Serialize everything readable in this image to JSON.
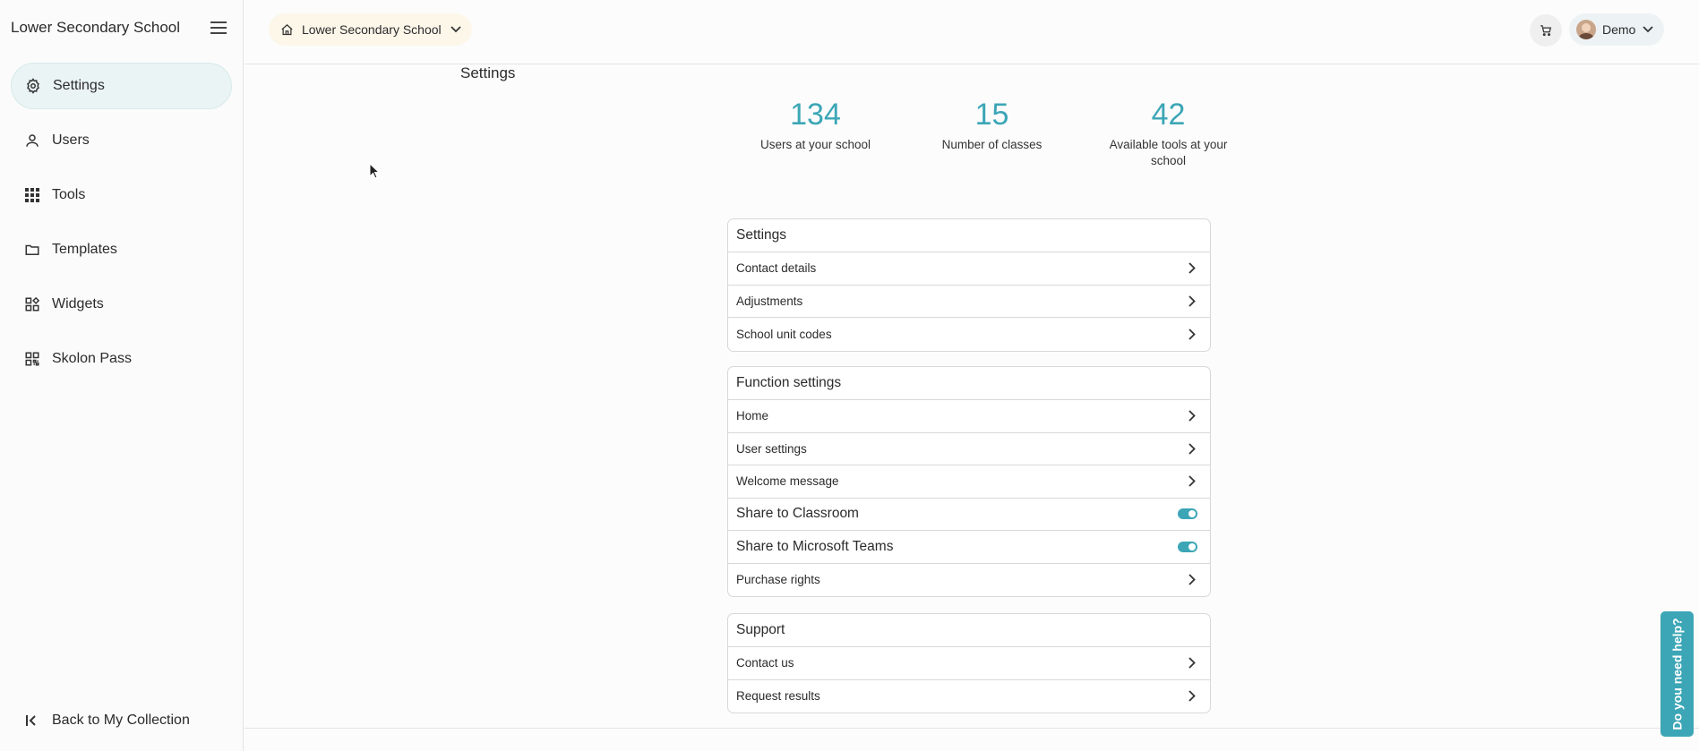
{
  "sidebar": {
    "title": "Lower Secondary School",
    "items": [
      {
        "label": "Settings",
        "icon": "gear-icon",
        "active": true
      },
      {
        "label": "Users",
        "icon": "user-icon"
      },
      {
        "label": "Tools",
        "icon": "grid-icon"
      },
      {
        "label": "Templates",
        "icon": "folder-icon"
      },
      {
        "label": "Widgets",
        "icon": "widgets-icon"
      },
      {
        "label": "Skolon Pass",
        "icon": "qr-code-icon"
      }
    ],
    "back_label": "Back to My Collection"
  },
  "topbar": {
    "school_select": "Lower Secondary School",
    "user_name": "Demo"
  },
  "main": {
    "title": "Settings",
    "stats": [
      {
        "value": "134",
        "label": "Users at your school"
      },
      {
        "value": "15",
        "label": "Number of classes"
      },
      {
        "value": "42",
        "label": "Available tools at your school"
      }
    ],
    "cards": [
      {
        "heading": "Settings",
        "rows": [
          {
            "label": "Contact details",
            "kind": "link"
          },
          {
            "label": "Adjustments",
            "kind": "link"
          },
          {
            "label": "School unit codes",
            "kind": "link"
          }
        ]
      },
      {
        "heading": "Function settings",
        "rows": [
          {
            "label": "Home",
            "kind": "link"
          },
          {
            "label": "User settings",
            "kind": "link"
          },
          {
            "label": "Welcome message",
            "kind": "link"
          },
          {
            "label": "Share to Classroom",
            "kind": "toggle",
            "on": true
          },
          {
            "label": "Share to Microsoft Teams",
            "kind": "toggle",
            "on": true
          },
          {
            "label": "Purchase rights",
            "kind": "link"
          }
        ]
      },
      {
        "heading": "Support",
        "rows": [
          {
            "label": "Contact us",
            "kind": "link"
          },
          {
            "label": "Request results",
            "kind": "link"
          }
        ]
      }
    ]
  },
  "help_tab": "Do you need help?",
  "colors": {
    "accent": "#3ca6b6",
    "active_nav": "#eaf4f4",
    "school_pill": "#fdf7ea"
  }
}
